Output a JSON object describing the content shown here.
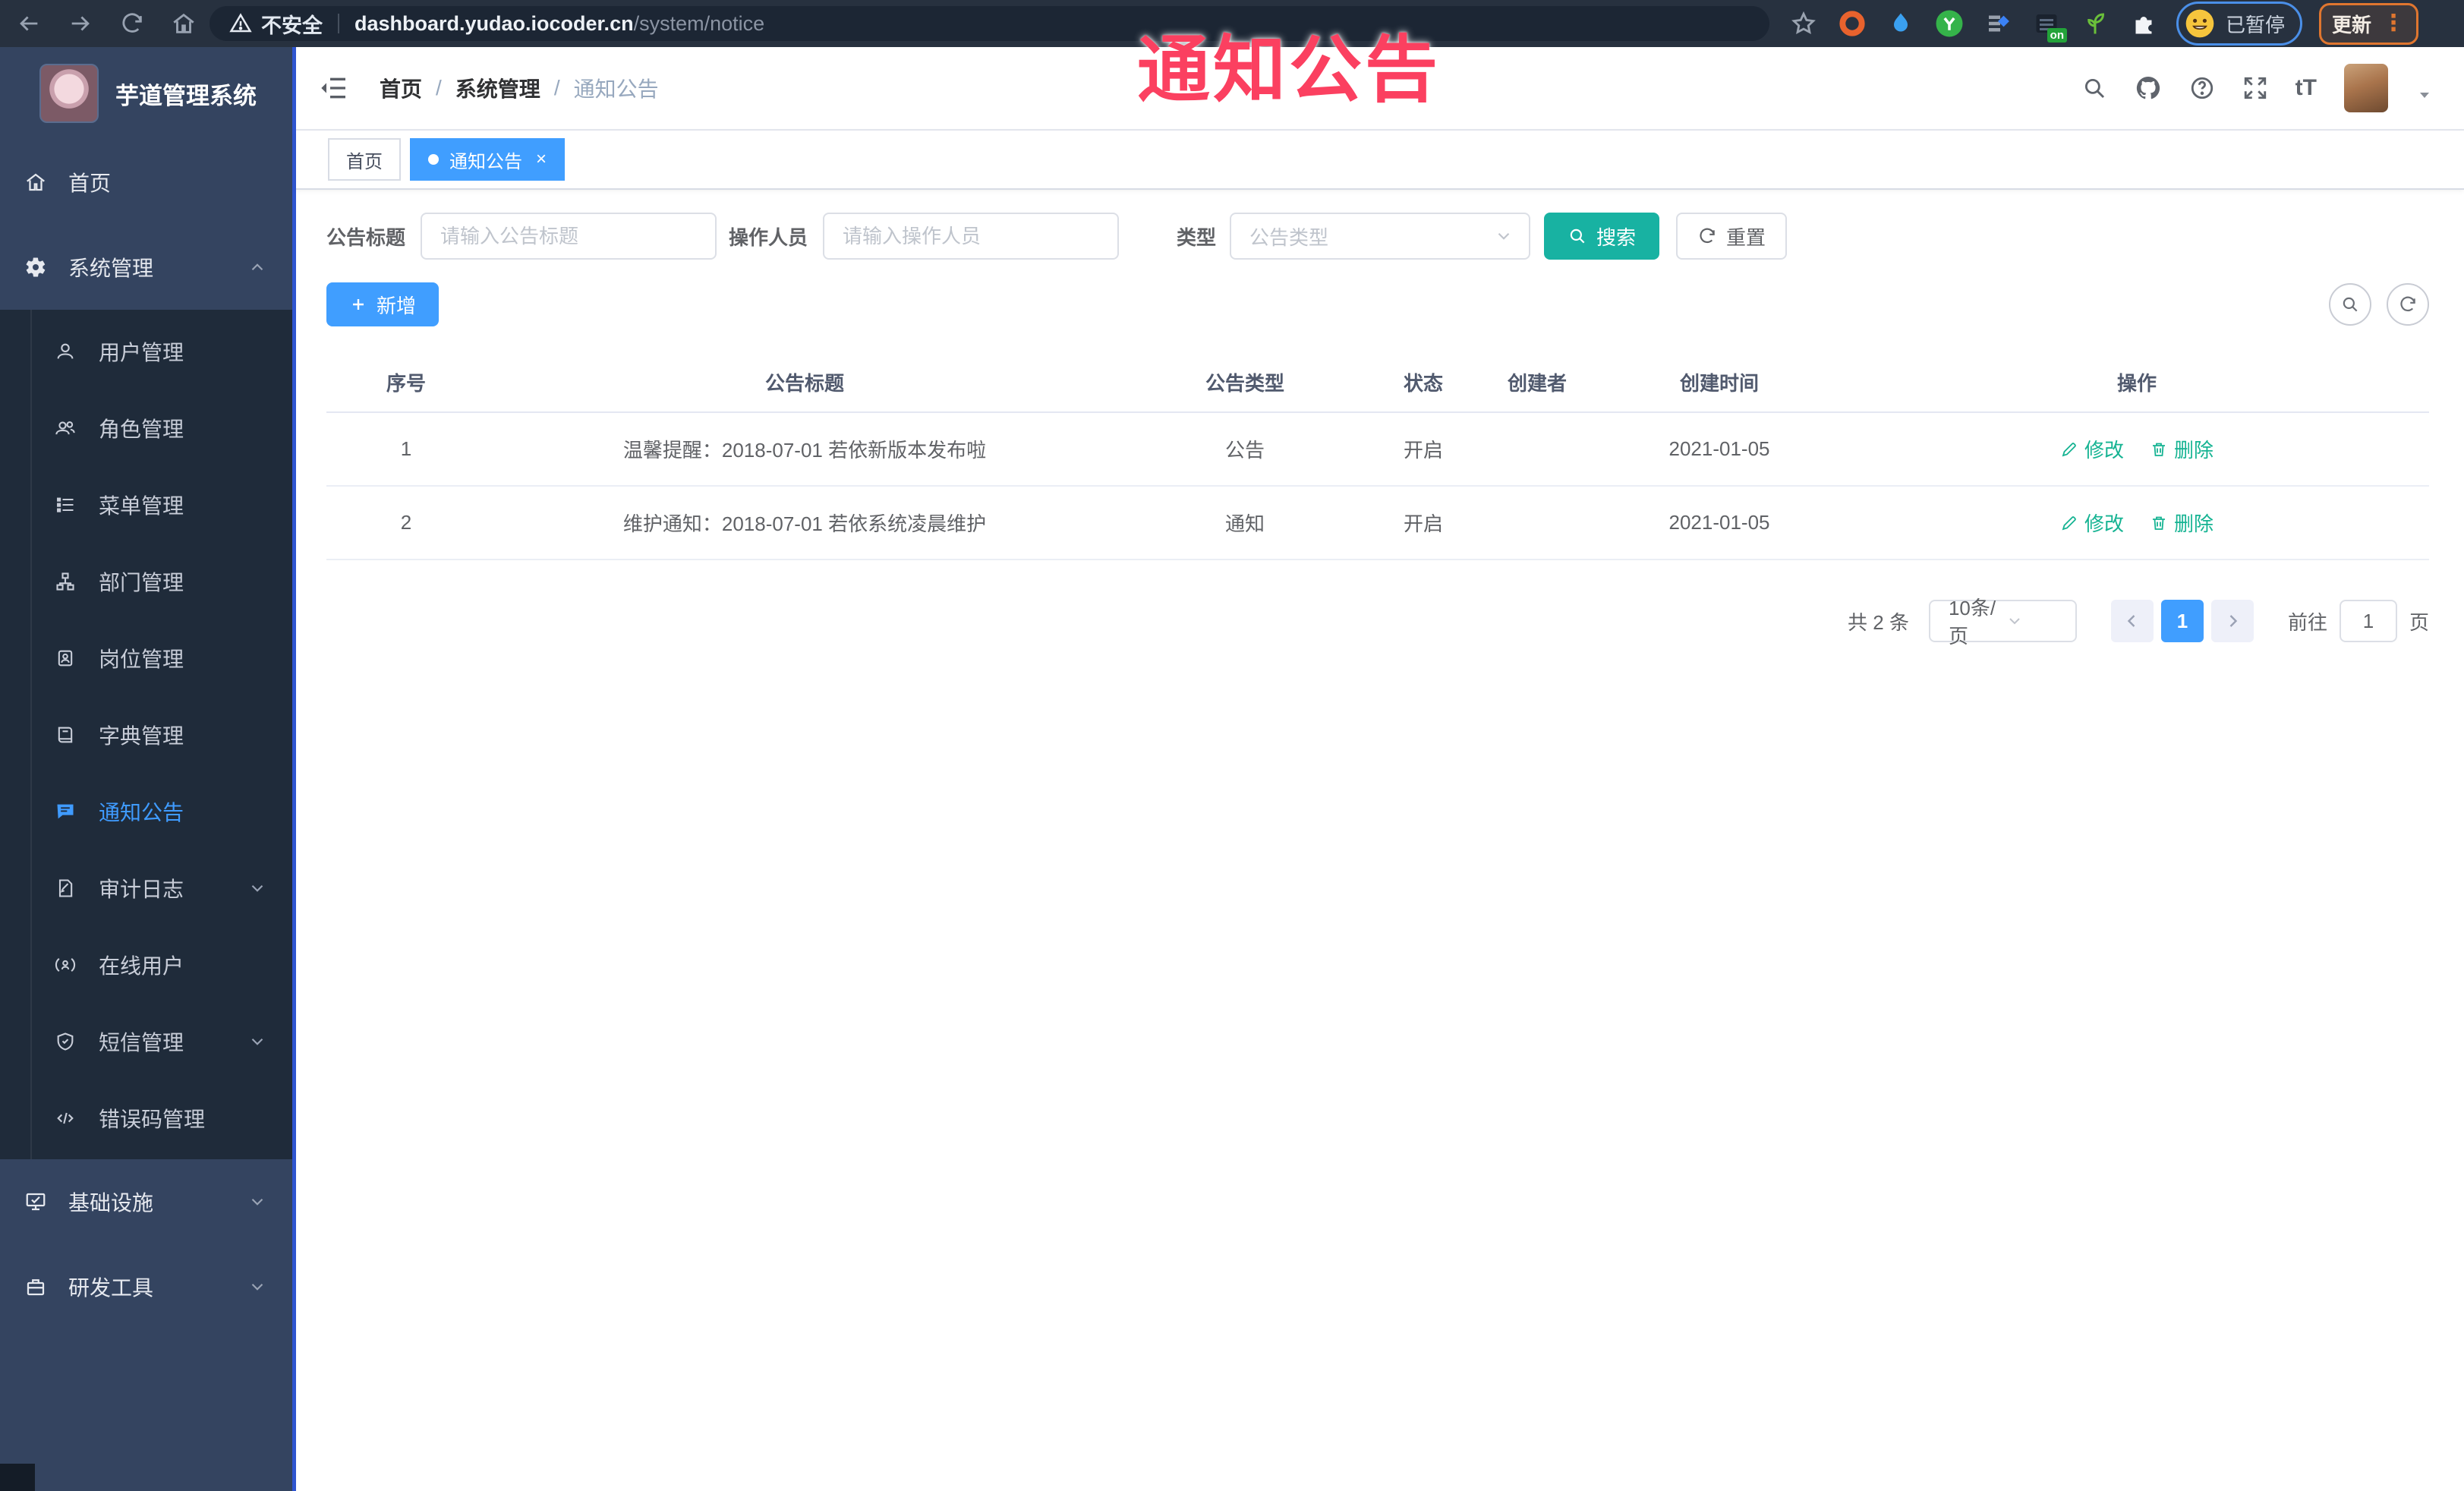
{
  "overlay": {
    "title": "通知公告"
  },
  "browser": {
    "security_label": "不安全",
    "url_host": "dashboard.yudao.iocoder.cn",
    "url_path": "/system/notice",
    "ext_badge": "on",
    "profile_status": "已暂停",
    "update_label": "更新"
  },
  "sidebar": {
    "app_title": "芋道管理系统",
    "items": [
      {
        "label": "首页"
      },
      {
        "label": "系统管理"
      },
      {
        "label": "用户管理"
      },
      {
        "label": "角色管理"
      },
      {
        "label": "菜单管理"
      },
      {
        "label": "部门管理"
      },
      {
        "label": "岗位管理"
      },
      {
        "label": "字典管理"
      },
      {
        "label": "通知公告"
      },
      {
        "label": "审计日志"
      },
      {
        "label": "在线用户"
      },
      {
        "label": "短信管理"
      },
      {
        "label": "错误码管理"
      },
      {
        "label": "基础设施"
      },
      {
        "label": "研发工具"
      }
    ]
  },
  "header": {
    "breadcrumb": [
      "首页",
      "系统管理",
      "通知公告"
    ]
  },
  "tabs": [
    {
      "label": "首页"
    },
    {
      "label": "通知公告"
    }
  ],
  "filters": {
    "title_label": "公告标题",
    "title_placeholder": "请输入公告标题",
    "operator_label": "操作人员",
    "operator_placeholder": "请输入操作人员",
    "type_label": "类型",
    "type_placeholder": "公告类型",
    "search_label": "搜索",
    "reset_label": "重置"
  },
  "toolbar": {
    "add_label": "新增"
  },
  "table": {
    "columns": [
      "序号",
      "公告标题",
      "公告类型",
      "状态",
      "创建者",
      "创建时间",
      "操作"
    ],
    "edit_label": "修改",
    "delete_label": "删除",
    "rows": [
      {
        "no": "1",
        "title": "温馨提醒：2018-07-01 若依新版本发布啦",
        "type": "公告",
        "status": "开启",
        "creator": "",
        "created": "2021-01-05"
      },
      {
        "no": "2",
        "title": "维护通知：2018-07-01 若依系统凌晨维护",
        "type": "通知",
        "status": "开启",
        "creator": "",
        "created": "2021-01-05"
      }
    ]
  },
  "pagination": {
    "total_text": "共 2 条",
    "page_size": "10条/页",
    "current_page": "1",
    "goto_label": "前往",
    "goto_value": "1",
    "unit_label": "页"
  },
  "colors": {
    "primary_blue": "#409EFF",
    "search_teal": "#18B2A2",
    "op_link_green": "#15B392",
    "overlay_red": "#FB4060",
    "sidebar_bg": "#344460",
    "submenu_bg": "#1F2B3A"
  }
}
